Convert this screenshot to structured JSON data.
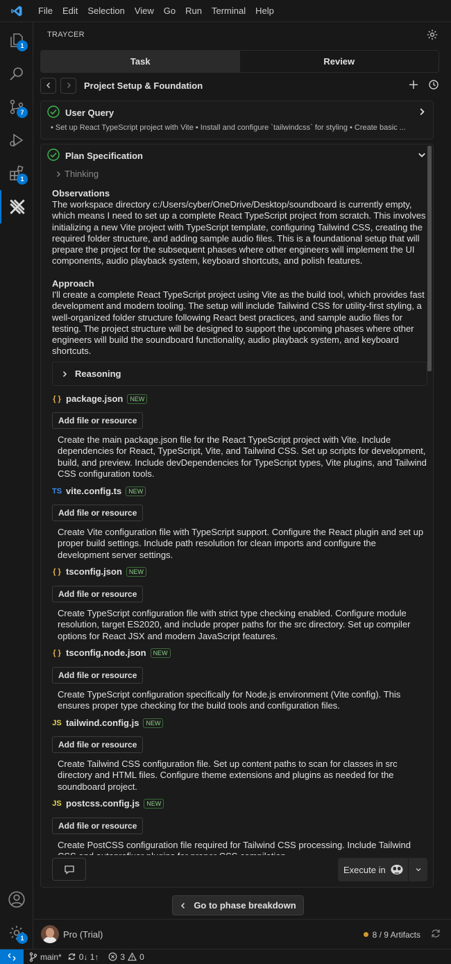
{
  "menu": [
    "File",
    "Edit",
    "Selection",
    "View",
    "Go",
    "Run",
    "Terminal",
    "Help"
  ],
  "activity": {
    "explorer_badge": "1",
    "scm_badge": "7",
    "extensions_badge": "1",
    "settings_badge": "1"
  },
  "panel": {
    "title": "TRAYCER",
    "tabs": [
      "Task",
      "Review"
    ],
    "breadcrumb_title": "Project Setup & Foundation"
  },
  "user_query": {
    "title": "User Query",
    "summary": "• Set up React TypeScript project with Vite • Install and configure `tailwindcss` for styling • Create basic ..."
  },
  "plan": {
    "title": "Plan Specification",
    "thinking": "Thinking",
    "observations_title": "Observations",
    "observations_body": "The workspace directory c:/Users/cyber/OneDrive/Desktop/soundboard is currently empty, which means I need to set up a complete React TypeScript project from scratch. This involves initializing a new Vite project with TypeScript template, configuring Tailwind CSS, creating the required folder structure, and adding sample audio files. This is a foundational setup that will prepare the project for the subsequent phases where other engineers will implement the UI components, audio playback system, keyboard shortcuts, and polish features.",
    "approach_title": "Approach",
    "approach_body": "I'll create a complete React TypeScript project using Vite as the build tool, which provides fast development and modern tooling. The setup will include Tailwind CSS for utility-first styling, a well-organized folder structure following React best practices, and sample audio files for testing. The project structure will be designed to support the upcoming phases where other engineers will build the soundboard functionality, audio playback system, and keyboard shortcuts.",
    "reasoning": "Reasoning",
    "add_label": "Add file or resource",
    "files": [
      {
        "icon": "{ }",
        "icon_color": "#e8b24a",
        "name": "package.json",
        "badge": "NEW",
        "desc": "Create the main package.json file for the React TypeScript project with Vite. Include dependencies for React, TypeScript, Vite, and Tailwind CSS. Set up scripts for development, build, and preview. Include devDependencies for TypeScript types, Vite plugins, and Tailwind CSS configuration tools."
      },
      {
        "icon": "TS",
        "icon_color": "#3b8eea",
        "name": "vite.config.ts",
        "badge": "NEW",
        "desc": "Create Vite configuration file with TypeScript support. Configure the React plugin and set up proper build settings. Include path resolution for clean imports and configure the development server settings."
      },
      {
        "icon": "{ }",
        "icon_color": "#e8b24a",
        "name": "tsconfig.json",
        "badge": "NEW",
        "desc": "Create TypeScript configuration file with strict type checking enabled. Configure module resolution, target ES2020, and include proper paths for the src directory. Set up compiler options for React JSX and modern JavaScript features."
      },
      {
        "icon": "{ }",
        "icon_color": "#e8b24a",
        "name": "tsconfig.node.json",
        "badge": "NEW",
        "desc": "Create TypeScript configuration specifically for Node.js environment (Vite config). This ensures proper type checking for the build tools and configuration files."
      },
      {
        "icon": "JS",
        "icon_color": "#e8d44d",
        "name": "tailwind.config.js",
        "badge": "NEW",
        "desc": "Create Tailwind CSS configuration file. Set up content paths to scan for classes in src directory and HTML files. Configure theme extensions and plugins as needed for the soundboard project."
      },
      {
        "icon": "JS",
        "icon_color": "#e8d44d",
        "name": "postcss.config.js",
        "badge": "NEW",
        "desc": "Create PostCSS configuration file required for Tailwind CSS processing. Include Tailwind CSS and autoprefixer plugins for proper CSS compilation."
      }
    ],
    "execute_label": "Execute in"
  },
  "phase_button": "Go to phase breakdown",
  "account": {
    "plan_label": "Pro (Trial)",
    "artifacts": "8 / 9 Artifacts"
  },
  "status": {
    "branch": "main*",
    "sync": "0↓ 1↑",
    "errors": "3",
    "warnings": "0"
  }
}
